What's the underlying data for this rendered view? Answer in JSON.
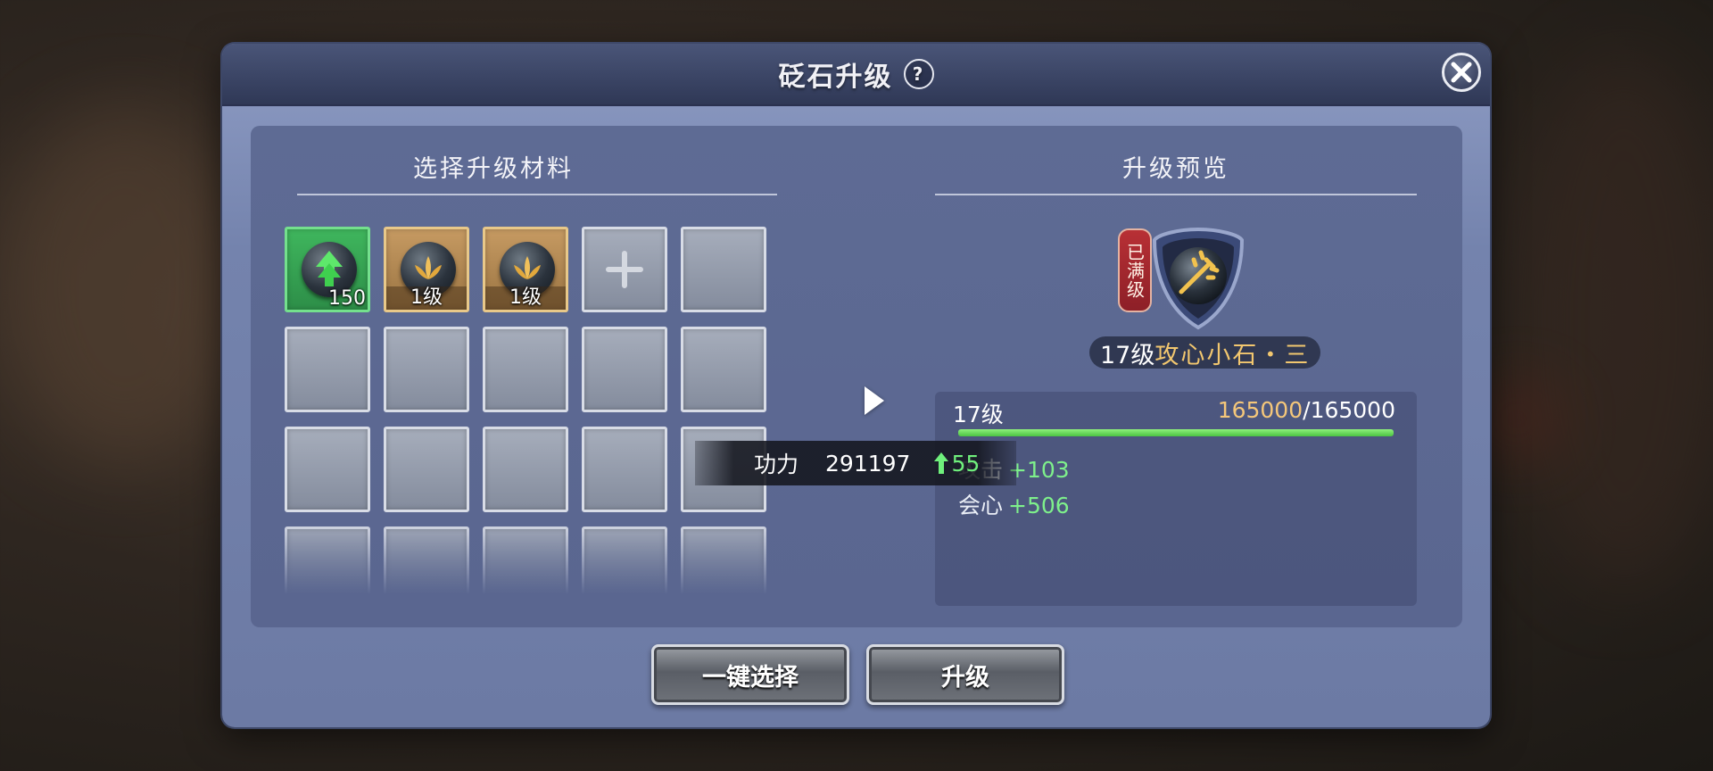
{
  "dialog": {
    "title": "砭石升级",
    "help_symbol": "?"
  },
  "materials": {
    "title": "选择升级材料",
    "slots": [
      {
        "type": "green",
        "label": "150",
        "icon": "upgrade-arrow-gem-icon"
      },
      {
        "type": "gold",
        "label": "1级",
        "icon": "lotus-gem-icon"
      },
      {
        "type": "gold",
        "label": "1级",
        "icon": "lotus-gem-icon"
      },
      {
        "type": "add",
        "icon": "plus-icon"
      }
    ]
  },
  "preview": {
    "title": "升级预览",
    "badge": "已满级",
    "stone_level": "17级",
    "stone_name": "攻心小石・三",
    "level_label": "17级",
    "exp_current": "165000",
    "exp_separator": "/",
    "exp_max": "165000",
    "exp_progress": 1.0,
    "stats": [
      {
        "name": "攻击",
        "value": "+103"
      },
      {
        "name": "会心",
        "value": "+506"
      }
    ]
  },
  "tooltip": {
    "label": "功力",
    "value": "291197",
    "increase": "55"
  },
  "buttons": {
    "auto_select": "一键选择",
    "upgrade": "升级"
  },
  "colors": {
    "accent_gold": "#f2c76f",
    "stat_green": "#7ef08b",
    "badge_red": "#b83035"
  }
}
